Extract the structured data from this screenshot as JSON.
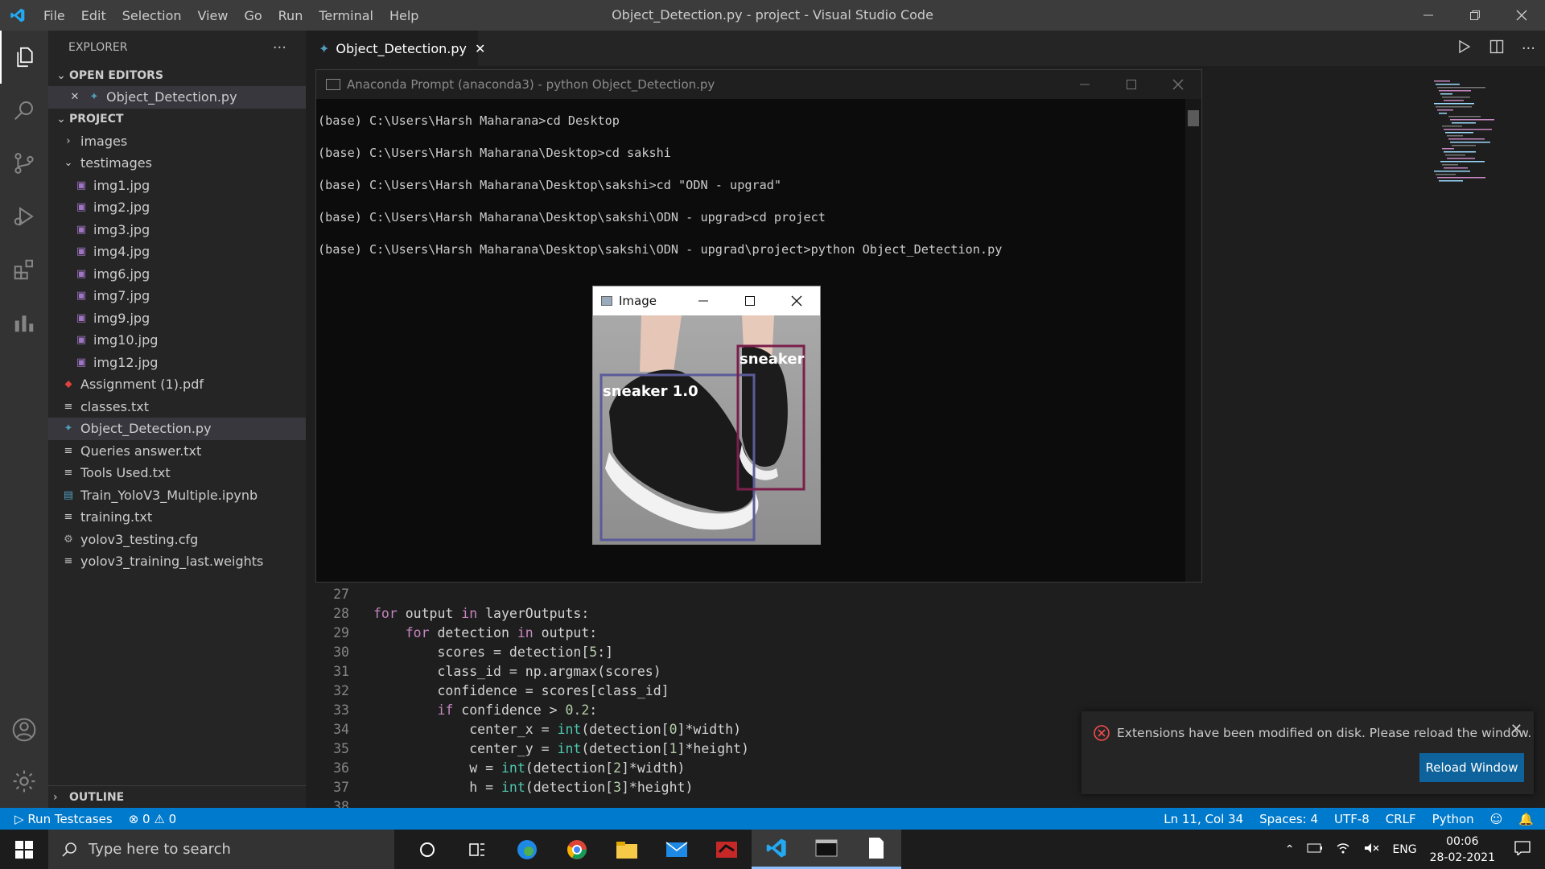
{
  "window": {
    "title": "Object_Detection.py - project - Visual Studio Code"
  },
  "menu": [
    "File",
    "Edit",
    "Selection",
    "View",
    "Go",
    "Run",
    "Terminal",
    "Help"
  ],
  "explorer": {
    "header": "EXPLORER",
    "open_editors_label": "OPEN EDITORS",
    "open_editors": [
      {
        "name": "Object_Detection.py"
      }
    ],
    "project_label": "PROJECT",
    "tree": [
      {
        "name": "images",
        "type": "folder",
        "expanded": false
      },
      {
        "name": "testimages",
        "type": "folder",
        "expanded": true
      },
      {
        "name": "img1.jpg",
        "type": "image"
      },
      {
        "name": "img2.jpg",
        "type": "image"
      },
      {
        "name": "img3.jpg",
        "type": "image"
      },
      {
        "name": "img4.jpg",
        "type": "image"
      },
      {
        "name": "img6.jpg",
        "type": "image"
      },
      {
        "name": "img7.jpg",
        "type": "image"
      },
      {
        "name": "img9.jpg",
        "type": "image"
      },
      {
        "name": "img10.jpg",
        "type": "image"
      },
      {
        "name": "img12.jpg",
        "type": "image"
      },
      {
        "name": "Assignment (1).pdf",
        "type": "pdf"
      },
      {
        "name": "classes.txt",
        "type": "text"
      },
      {
        "name": "Object_Detection.py",
        "type": "python",
        "selected": true
      },
      {
        "name": "Queries answer.txt",
        "type": "text"
      },
      {
        "name": "Tools Used.txt",
        "type": "text"
      },
      {
        "name": "Train_YoloV3_Multiple.ipynb",
        "type": "notebook"
      },
      {
        "name": "training.txt",
        "type": "text"
      },
      {
        "name": "yolov3_testing.cfg",
        "type": "config"
      },
      {
        "name": "yolov3_training_last.weights",
        "type": "text"
      }
    ],
    "outline_label": "OUTLINE"
  },
  "tab": {
    "label": "Object_Detection.py"
  },
  "code": [
    {
      "n": "27",
      "t": ""
    },
    {
      "n": "28",
      "t": "for output in layerOutputs:"
    },
    {
      "n": "29",
      "t": "    for detection in output:"
    },
    {
      "n": "30",
      "t": "        scores = detection[5:]"
    },
    {
      "n": "31",
      "t": "        class_id = np.argmax(scores)"
    },
    {
      "n": "32",
      "t": "        confidence = scores[class_id]"
    },
    {
      "n": "33",
      "t": "        if confidence > 0.2:"
    },
    {
      "n": "34",
      "t": "            center_x = int(detection[0]*width)"
    },
    {
      "n": "35",
      "t": "            center_y = int(detection[1]*height)"
    },
    {
      "n": "36",
      "t": "            w = int(detection[2]*width)"
    },
    {
      "n": "37",
      "t": "            h = int(detection[3]*height)"
    },
    {
      "n": "38",
      "t": ""
    }
  ],
  "console": {
    "title": "Anaconda Prompt (anaconda3) - python  Object_Detection.py",
    "lines": [
      "(base) C:\\Users\\Harsh Maharana>cd Desktop",
      "(base) C:\\Users\\Harsh Maharana\\Desktop>cd sakshi",
      "(base) C:\\Users\\Harsh Maharana\\Desktop\\sakshi>cd \"ODN - upgrad\"",
      "(base) C:\\Users\\Harsh Maharana\\Desktop\\sakshi\\ODN - upgrad>cd project",
      "(base) C:\\Users\\Harsh Maharana\\Desktop\\sakshi\\ODN - upgrad\\project>python Object_Detection.py"
    ]
  },
  "image_window": {
    "title": "Image",
    "labels": [
      "sneaker 1.0",
      "sneaker"
    ],
    "box_colors": [
      "#5b5b99",
      "#7a1f4a"
    ]
  },
  "notification": {
    "message": "Extensions have been modified on disk. Please reload the window.",
    "button": "Reload Window"
  },
  "status": {
    "run": "Run Testcases",
    "errors": "0",
    "warnings": "0",
    "position": "Ln 11, Col 34",
    "spaces": "Spaces: 4",
    "encoding": "UTF-8",
    "eol": "CRLF",
    "language": "Python"
  },
  "taskbar": {
    "search_placeholder": "Type here to search",
    "lang": "ENG",
    "time": "00:06",
    "date": "28-02-2021"
  },
  "colors": {
    "accent": "#007acc",
    "titlebar": "#3c3c3c",
    "sidebar": "#252526",
    "editor": "#1e1e1e",
    "button": "#0e639c"
  }
}
